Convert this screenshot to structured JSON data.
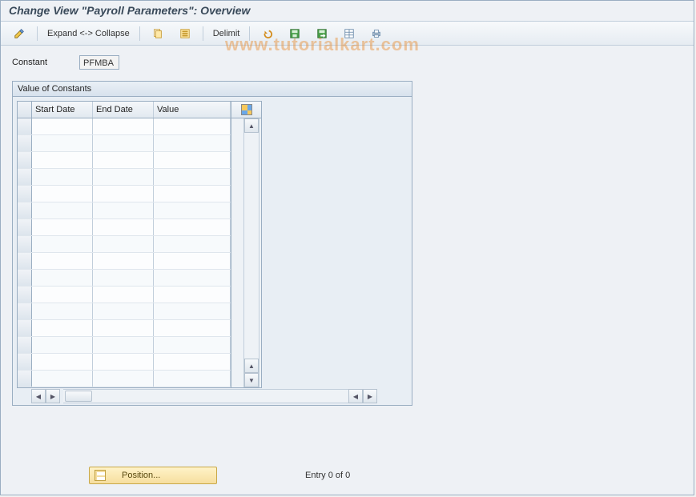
{
  "title": "Change View \"Payroll Parameters\": Overview",
  "watermark": "www.tutorialkart.com",
  "toolbar": {
    "expand_label": "Expand <-> Collapse",
    "delimit_label": "Delimit"
  },
  "field": {
    "constant_label": "Constant",
    "constant_value": "PFMBA"
  },
  "panel": {
    "title": "Value of Constants",
    "columns": {
      "start": "Start Date",
      "end": "End Date",
      "value": "Value"
    },
    "row_count": 16
  },
  "footer": {
    "position_label": "Position...",
    "entry_text": "Entry 0 of 0"
  }
}
